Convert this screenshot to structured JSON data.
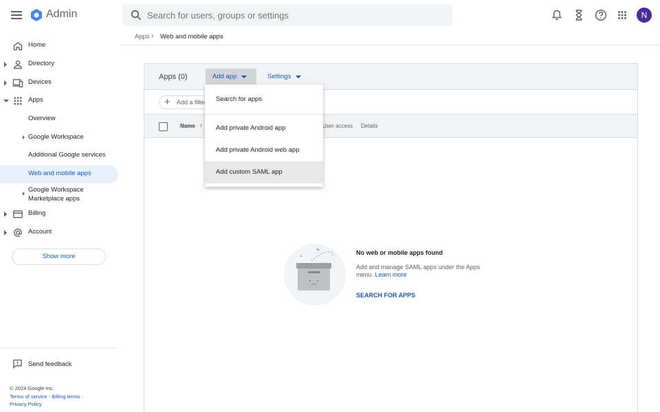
{
  "header": {
    "brand": "Admin",
    "search_placeholder": "Search for users, groups or settings",
    "avatar_initial": "N"
  },
  "sidebar": {
    "items": [
      {
        "label": "Home"
      },
      {
        "label": "Directory"
      },
      {
        "label": "Devices"
      },
      {
        "label": "Apps"
      },
      {
        "label": "Overview"
      },
      {
        "label": "Google Workspace"
      },
      {
        "label": "Additional Google services"
      },
      {
        "label": "Web and mobile apps"
      },
      {
        "label": "Google Workspace"
      },
      {
        "label": "Marketplace apps"
      },
      {
        "label": "Billing"
      },
      {
        "label": "Account"
      }
    ],
    "show_more": "Show more",
    "feedback": "Send feedback",
    "copyright": "© 2024 Google Inc.",
    "terms": "Terms of service",
    "billing_terms": "Billing terms",
    "privacy": "Privacy Policy"
  },
  "breadcrumb": {
    "parent": "Apps",
    "current": "Web and mobile apps"
  },
  "panel": {
    "apps_count": "Apps (0)",
    "add_app": "Add app",
    "settings": "Settings",
    "add_filter": "Add a filter",
    "columns": {
      "name": "Name",
      "user_access": "User access",
      "details": "Details"
    }
  },
  "dropdown": {
    "items": [
      {
        "label": "Search for apps"
      },
      {
        "label": "Add private Android app"
      },
      {
        "label": "Add private Android web app"
      },
      {
        "label": "Add custom SAML app"
      }
    ]
  },
  "empty_state": {
    "title": "No web or mobile apps found",
    "desc_line1": "Add and manage SAML apps under the Apps",
    "desc_line2": "menu.",
    "learn_more": "Learn more",
    "action": "SEARCH FOR APPS"
  },
  "colors": {
    "accent": "#1a57b8",
    "avatar": "#4a2c9b",
    "active_nav": "#e8f0fe"
  }
}
